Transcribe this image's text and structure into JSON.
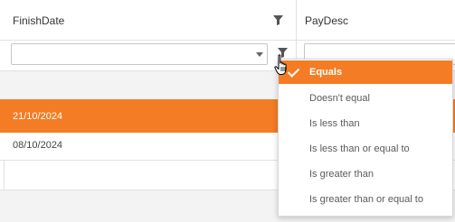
{
  "columns": {
    "finish_date": {
      "header": "FinishDate",
      "filter_value": ""
    },
    "pay_desc": {
      "header": "PayDesc",
      "filter_value": ""
    }
  },
  "rows": [
    {
      "finish_date": "21/10/2024",
      "selected": true
    },
    {
      "finish_date": "08/10/2024",
      "selected": false
    }
  ],
  "filter_menu": {
    "options": [
      {
        "label": "Equals",
        "selected": true
      },
      {
        "label": "Doesn't equal",
        "selected": false
      },
      {
        "label": "Is less than",
        "selected": false
      },
      {
        "label": "Is less than or equal to",
        "selected": false
      },
      {
        "label": "Is greater than",
        "selected": false
      },
      {
        "label": "Is greater than or equal to",
        "selected": false
      }
    ]
  },
  "colors": {
    "accent": "#f47c24",
    "grid_line": "#e2e2e2",
    "band": "#f3f3f3"
  },
  "icons": {
    "filter": "funnel-icon",
    "check": "check-icon",
    "caret": "chevron-down-icon",
    "cursor": "hand-pointer-icon"
  }
}
